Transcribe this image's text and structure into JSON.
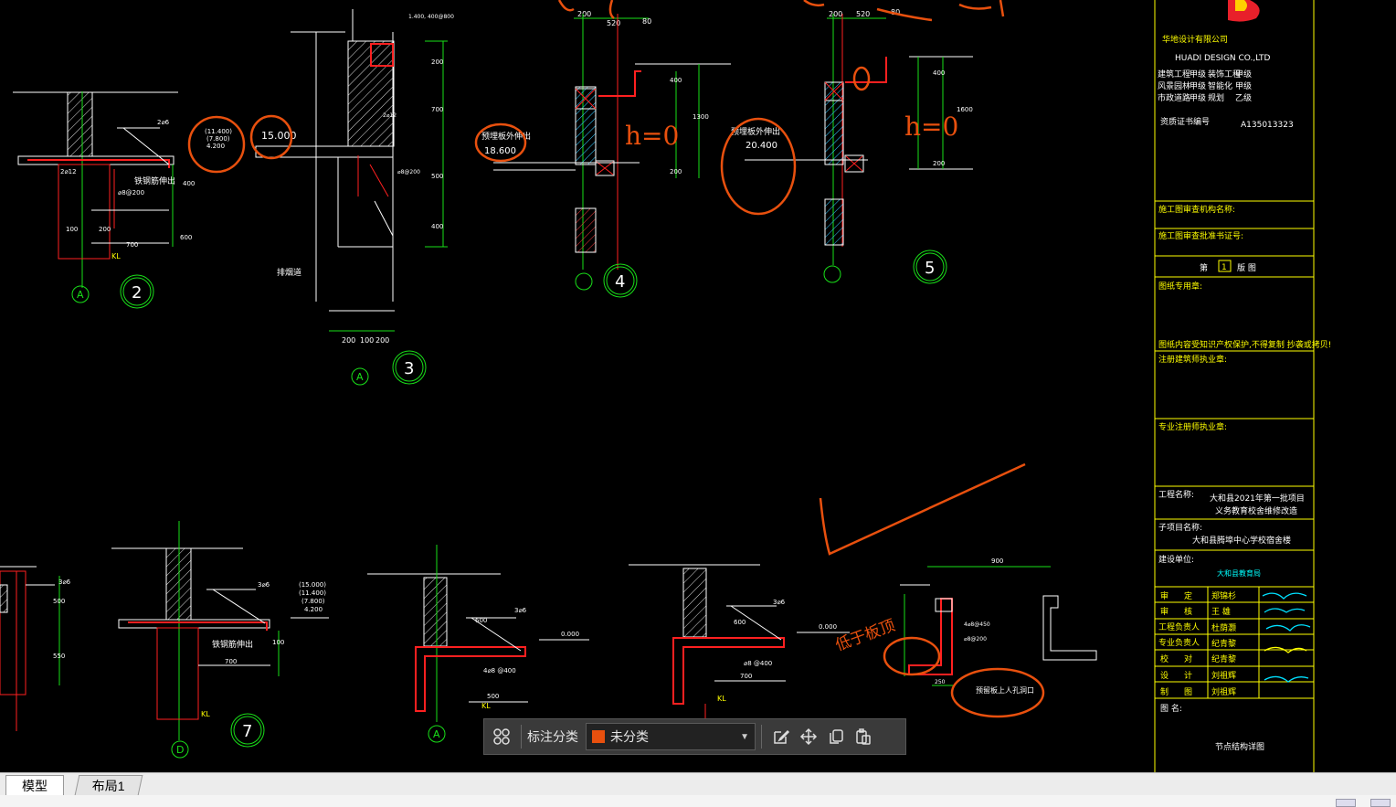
{
  "toolbar": {
    "category_label": "标注分类",
    "category_value": "未分类",
    "category_color": "#e8500e",
    "icons": [
      "grid-icon",
      "edit-icon",
      "move-icon",
      "copy-icon",
      "paste-icon"
    ]
  },
  "tabs": [
    "模型",
    "布局1"
  ],
  "drawing": {
    "details": [
      "2",
      "3",
      "4",
      "5",
      "7"
    ],
    "axis_labels": [
      "A",
      "A",
      "A",
      "D"
    ],
    "levels": {
      "d2": [
        "(11.400)",
        "(7.800)",
        "4.200"
      ],
      "d3": "15.000",
      "d4": "18.600",
      "d5": "20.400",
      "d7": [
        "(15.000)",
        "(11.400)",
        "(7.800)",
        "4.200"
      ],
      "d8": "0.000",
      "d9": "0.000"
    },
    "labels": {
      "steel_pipe": "铁钢筋伸出",
      "rebar_2c12": "2⌀12",
      "stirrup": "⌀8@200",
      "kl": "KL",
      "flue": "排烟道",
      "leave": "预留板上人孔洞口",
      "embed_pipe": "预埋板外伸出"
    },
    "dims": {
      "d3_bottom": [
        "200",
        "100",
        "200"
      ],
      "d4_top": [
        "200",
        "520",
        "80"
      ],
      "d5_top": [
        "200",
        "520",
        "80"
      ],
      "d4_right": [
        "400",
        "1300",
        "200"
      ],
      "d5_right": [
        "400",
        "1600",
        "200"
      ],
      "d2": [
        "100",
        "200",
        "700",
        "400",
        "600"
      ],
      "d3_right": [
        "200",
        "700",
        "500",
        "400"
      ],
      "d7": [
        "700",
        "100",
        "500"
      ],
      "d8": [
        "600",
        "500",
        "3⌀6"
      ],
      "d9": [
        "600",
        "700",
        "3⌀6"
      ]
    },
    "handwriting": [
      "h=0",
      "h=0",
      "低于板顶"
    ]
  },
  "titleblock": {
    "company": "华地设计有限公司",
    "company_en": "HUADI  DESIGN  CO.,LTD",
    "qual_rows": [
      [
        "建筑工程",
        "甲级",
        "装饰工程",
        "甲级"
      ],
      [
        "风景园林",
        "甲级",
        "智能化",
        "甲级"
      ],
      [
        "市政道路",
        "甲级",
        "规划",
        "乙级"
      ]
    ],
    "cert_label": "资质证书编号",
    "cert_no": "A135013323",
    "review_org": "施工图审查机构名称:",
    "review_no": "施工图审查批准书证号:",
    "edition_prefix": "第",
    "edition_no": "1",
    "edition_suffix": "版 图",
    "usage_label": "图纸专用章:",
    "copyright": "图纸内容受知识产权保护,不得复制  抄袭或拷贝!",
    "reg_architect": "注册建筑师执业章:",
    "pro_engineer": "专业注册师执业章:",
    "project_label": "工程名称:",
    "project_name_1": "大和县2021年第一批项目",
    "project_name_2": "义务教育校舍维修改造",
    "sub_label": "子项目名称:",
    "sub_name": "大和县腾埠中心学校宿舍楼",
    "client_label": "建设单位:",
    "client_name": "大和县教育局",
    "staff": [
      [
        "审",
        "定",
        "郑锦杉"
      ],
      [
        "审",
        "核",
        "王  雄"
      ],
      [
        "工程负责人",
        "",
        "杜荫灏"
      ],
      [
        "专业负责人",
        "",
        "纪青黎"
      ],
      [
        "校",
        "对",
        "纪青黎"
      ],
      [
        "设",
        "计",
        "刘祖辉"
      ],
      [
        "制",
        "图",
        "刘祖辉"
      ]
    ],
    "drawing_name_label": "图 名:",
    "drawing_name": "节点结构详图"
  },
  "colors": {
    "wall": "#ffffff",
    "red": "#ff2020",
    "green": "#19e019",
    "yellow": "#ffff00",
    "cyan": "#00ffff",
    "markup": "#e8500e"
  }
}
